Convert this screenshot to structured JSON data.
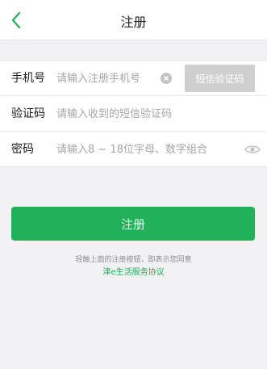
{
  "header": {
    "title": "注册",
    "back_icon": "chevron-left-icon"
  },
  "form": {
    "phone": {
      "label": "手机号",
      "placeholder": "请输入注册手机号",
      "clear_icon": "clear-circle-icon",
      "sms_button": "短信验证码"
    },
    "code": {
      "label": "验证码",
      "placeholder": "请输入收到的短信验证码"
    },
    "password": {
      "label": "密码",
      "placeholder": "请输入8 ~ 18位字母、数字组合",
      "eye_icon": "eye-icon"
    }
  },
  "submit_label": "注册",
  "agreement": {
    "prefix": "轻触上面的注册按钮，即表示您同意",
    "link": "津e生活服务协议"
  },
  "colors": {
    "accent": "#20b15a",
    "background": "#f2f2f4",
    "disabled_button": "#cfcfcf"
  }
}
